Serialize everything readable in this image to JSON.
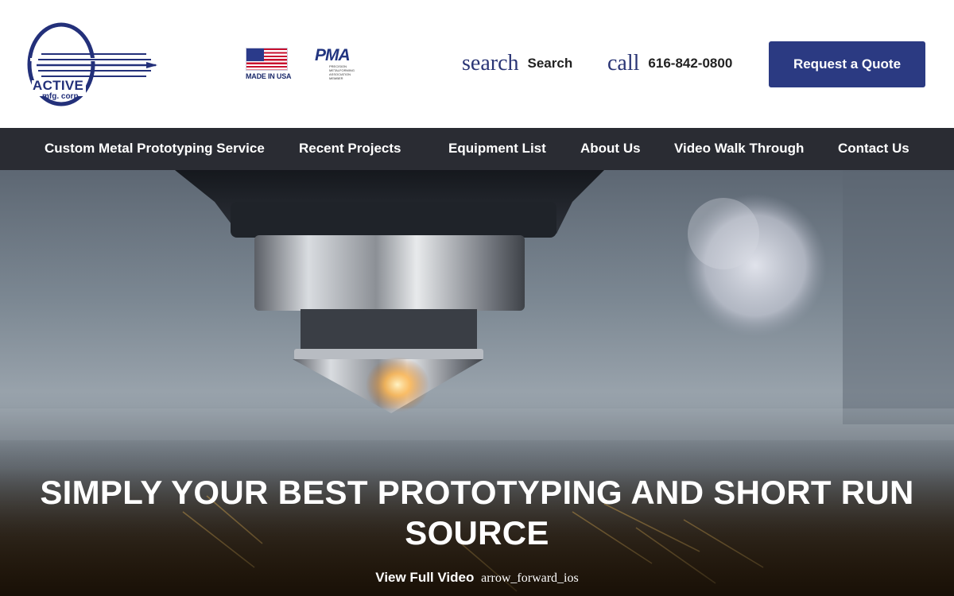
{
  "header": {
    "logo": {
      "name": "ACTIVE",
      "sub": "mfg. corp."
    },
    "badges": {
      "made_in_usa": "MADE IN USA",
      "pma": "PMA",
      "pma_lines": [
        "PRECISION",
        "METALFORMING",
        "ASSOCIATION",
        "MEMBER"
      ]
    },
    "search": {
      "icon": "search",
      "label": "Search"
    },
    "call": {
      "icon": "call",
      "phone": "616-842-0800"
    },
    "quote_button": "Request a Quote"
  },
  "nav": {
    "items": [
      {
        "label": "Custom Metal Prototyping Service"
      },
      {
        "label": "Recent Projects"
      },
      {
        "label": "Equipment List"
      },
      {
        "label": "About Us"
      },
      {
        "label": "Video Walk Through"
      },
      {
        "label": "Contact Us"
      }
    ]
  },
  "hero": {
    "title": "SIMPLY YOUR BEST PROTOTYPING AND SHORT RUN SOURCE",
    "video_link": "View Full Video",
    "video_icon": "arrow_forward_ios"
  },
  "colors": {
    "brand_blue": "#2b3a82",
    "nav_bg": "#2a2c33",
    "icon_blue": "#2a3575"
  }
}
